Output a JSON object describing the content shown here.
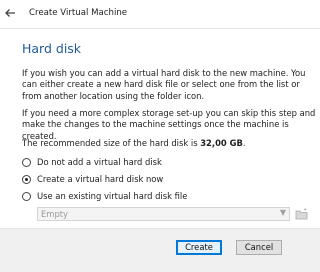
{
  "window": {
    "title": "Create Virtual Machine",
    "back_icon": "back-arrow-icon"
  },
  "page": {
    "title": "Hard disk",
    "intro": "If you wish you can add a virtual hard disk to the new machine. You can either create a new hard disk file or select one from the list or from another location using the folder icon.",
    "complex": "If you need a more complex storage set-up you can skip this step and make the changes to the machine settings once the machine is created.",
    "recommended_prefix": "The recommended size of the hard disk is ",
    "recommended_size": "32,00 GB",
    "recommended_suffix": "."
  },
  "options": [
    {
      "label": "Do not add a virtual hard disk",
      "selected": false
    },
    {
      "label": "Create a virtual hard disk now",
      "selected": true
    },
    {
      "label": "Use an existing virtual hard disk file",
      "selected": false
    }
  ],
  "existing_disk": {
    "value": "Empty",
    "enabled": false,
    "folder_icon": "folder-icon"
  },
  "buttons": {
    "create": "Create",
    "cancel": "Cancel"
  },
  "colors": {
    "title_accent": "#1f5a9a",
    "default_button_border": "#0078d7"
  }
}
